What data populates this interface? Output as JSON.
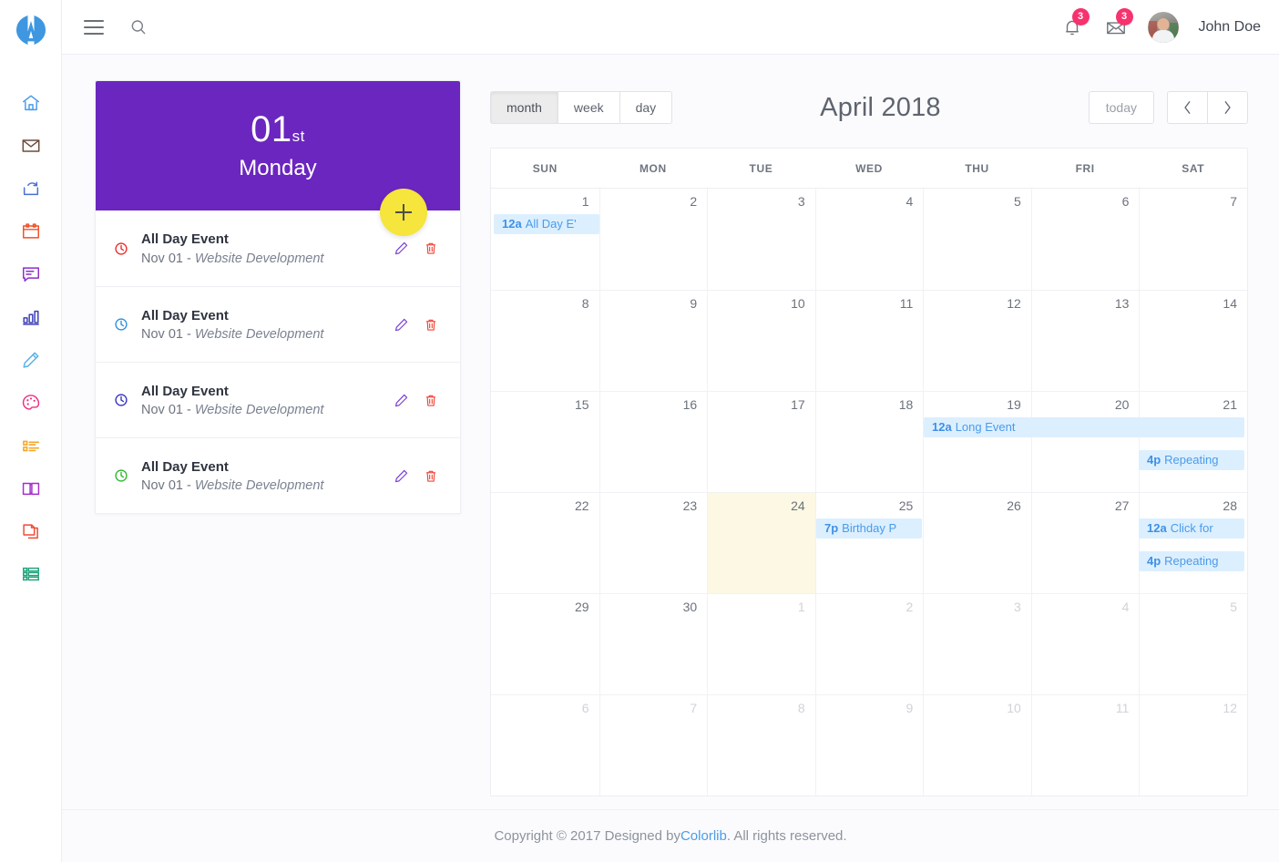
{
  "brand": {
    "logo_alt": "app-logo"
  },
  "rail": {
    "items": [
      {
        "name": "home-icon",
        "label": "Home",
        "color": "#4a9bea"
      },
      {
        "name": "mail-icon",
        "label": "Email",
        "color": "#6b4c3b"
      },
      {
        "name": "share-icon",
        "label": "Share",
        "color": "#4a6fd4"
      },
      {
        "name": "calendar-icon",
        "label": "Calendar",
        "color": "#f0512a"
      },
      {
        "name": "chat-icon",
        "label": "Chat",
        "color": "#8b2fc9"
      },
      {
        "name": "chart-icon",
        "label": "Charts",
        "color": "#3b3fb5"
      },
      {
        "name": "pencil-icon",
        "label": "Forms",
        "color": "#57b0e8"
      },
      {
        "name": "palette-icon",
        "label": "Styles",
        "color": "#ed2f7e"
      },
      {
        "name": "list-icon",
        "label": "Lists",
        "color": "#f5a623"
      },
      {
        "name": "book-icon",
        "label": "Pages",
        "color": "#a32fc9"
      },
      {
        "name": "copy-icon",
        "label": "Documents",
        "color": "#ef4b35"
      },
      {
        "name": "table-icon",
        "label": "Tables",
        "color": "#1fa37a"
      }
    ]
  },
  "topbar": {
    "menu_label": "Menu",
    "search_label": "Search",
    "notifications_count": "3",
    "messages_count": "3",
    "username": "John Doe"
  },
  "day_card": {
    "day_number": "01",
    "day_suffix": "st",
    "day_name": "Monday",
    "add_label": "+",
    "events": [
      {
        "title": "All Day Event",
        "date": "Nov 01 - ",
        "project": "Website Development",
        "dot_color": "#ef2b2b",
        "edit_label": "Edit",
        "delete_label": "Delete"
      },
      {
        "title": "All Day Event",
        "date": "Nov 01 - ",
        "project": "Website Development",
        "dot_color": "#2e8fe0",
        "edit_label": "Edit",
        "delete_label": "Delete"
      },
      {
        "title": "All Day Event",
        "date": "Nov 01 - ",
        "project": "Website Development",
        "dot_color": "#3730c4",
        "edit_label": "Edit",
        "delete_label": "Delete"
      },
      {
        "title": "All Day Event",
        "date": "Nov 01 - ",
        "project": "Website Development",
        "dot_color": "#2eb82e",
        "edit_label": "Edit",
        "delete_label": "Delete"
      }
    ]
  },
  "calendar": {
    "views": [
      {
        "id": "month",
        "label": "month",
        "active": true
      },
      {
        "id": "week",
        "label": "week",
        "active": false
      },
      {
        "id": "day",
        "label": "day",
        "active": false
      }
    ],
    "title": "April 2018",
    "today_label": "today",
    "prev_label": "‹",
    "next_label": "›",
    "dow": [
      "SUN",
      "MON",
      "TUE",
      "WED",
      "THU",
      "FRI",
      "SAT"
    ],
    "weeks": [
      {
        "days": [
          {
            "n": "1",
            "other": false,
            "today": false
          },
          {
            "n": "2",
            "other": false,
            "today": false
          },
          {
            "n": "3",
            "other": false,
            "today": false
          },
          {
            "n": "4",
            "other": false,
            "today": false
          },
          {
            "n": "5",
            "other": false,
            "today": false
          },
          {
            "n": "6",
            "other": false,
            "today": false
          },
          {
            "n": "7",
            "other": false,
            "today": false
          }
        ],
        "events": [
          {
            "col": 1,
            "span": 1,
            "row": 1,
            "time": "12a",
            "text": "All Day E'"
          }
        ]
      },
      {
        "days": [
          {
            "n": "8",
            "other": false,
            "today": false
          },
          {
            "n": "9",
            "other": false,
            "today": false
          },
          {
            "n": "10",
            "other": false,
            "today": false
          },
          {
            "n": "11",
            "other": false,
            "today": false
          },
          {
            "n": "12",
            "other": false,
            "today": false
          },
          {
            "n": "13",
            "other": false,
            "today": false
          },
          {
            "n": "14",
            "other": false,
            "today": false
          }
        ],
        "events": []
      },
      {
        "days": [
          {
            "n": "15",
            "other": false,
            "today": false
          },
          {
            "n": "16",
            "other": false,
            "today": false
          },
          {
            "n": "17",
            "other": false,
            "today": false
          },
          {
            "n": "18",
            "other": false,
            "today": false
          },
          {
            "n": "19",
            "other": false,
            "today": false
          },
          {
            "n": "20",
            "other": false,
            "today": false
          },
          {
            "n": "21",
            "other": false,
            "today": false
          }
        ],
        "events": [
          {
            "col": 5,
            "span": 3,
            "row": 1,
            "time": "12a",
            "text": "Long Event"
          },
          {
            "col": 7,
            "span": 1,
            "row": 2,
            "time": "4p",
            "text": "Repeating"
          }
        ]
      },
      {
        "days": [
          {
            "n": "22",
            "other": false,
            "today": false
          },
          {
            "n": "23",
            "other": false,
            "today": false
          },
          {
            "n": "24",
            "other": false,
            "today": true
          },
          {
            "n": "25",
            "other": false,
            "today": false
          },
          {
            "n": "26",
            "other": false,
            "today": false
          },
          {
            "n": "27",
            "other": false,
            "today": false
          },
          {
            "n": "28",
            "other": false,
            "today": false
          }
        ],
        "events": [
          {
            "col": 4,
            "span": 1,
            "row": 1,
            "time": "7p",
            "text": "Birthday P"
          },
          {
            "col": 7,
            "span": 1,
            "row": 1,
            "time": "12a",
            "text": "Click for"
          },
          {
            "col": 7,
            "span": 1,
            "row": 2,
            "time": "4p",
            "text": "Repeating"
          }
        ]
      },
      {
        "days": [
          {
            "n": "29",
            "other": false,
            "today": false
          },
          {
            "n": "30",
            "other": false,
            "today": false
          },
          {
            "n": "1",
            "other": true,
            "today": false
          },
          {
            "n": "2",
            "other": true,
            "today": false
          },
          {
            "n": "3",
            "other": true,
            "today": false
          },
          {
            "n": "4",
            "other": true,
            "today": false
          },
          {
            "n": "5",
            "other": true,
            "today": false
          }
        ],
        "events": []
      },
      {
        "days": [
          {
            "n": "6",
            "other": true,
            "today": false
          },
          {
            "n": "7",
            "other": true,
            "today": false
          },
          {
            "n": "8",
            "other": true,
            "today": false
          },
          {
            "n": "9",
            "other": true,
            "today": false
          },
          {
            "n": "10",
            "other": true,
            "today": false
          },
          {
            "n": "11",
            "other": true,
            "today": false
          },
          {
            "n": "12",
            "other": true,
            "today": false
          }
        ],
        "events": []
      }
    ]
  },
  "footer": {
    "prefix": "Copyright © 2017 Designed by ",
    "link": "Colorlib",
    "suffix": ". All rights reserved."
  },
  "colors": {
    "brand_purple": "#6b26bf",
    "accent_yellow": "#f5e53c",
    "badge_pink": "#f6336e",
    "event_chip_bg": "#dcefff",
    "event_chip_text": "#4a9bea",
    "today_bg": "#fcf8e3",
    "link_blue": "#4a9bea"
  }
}
